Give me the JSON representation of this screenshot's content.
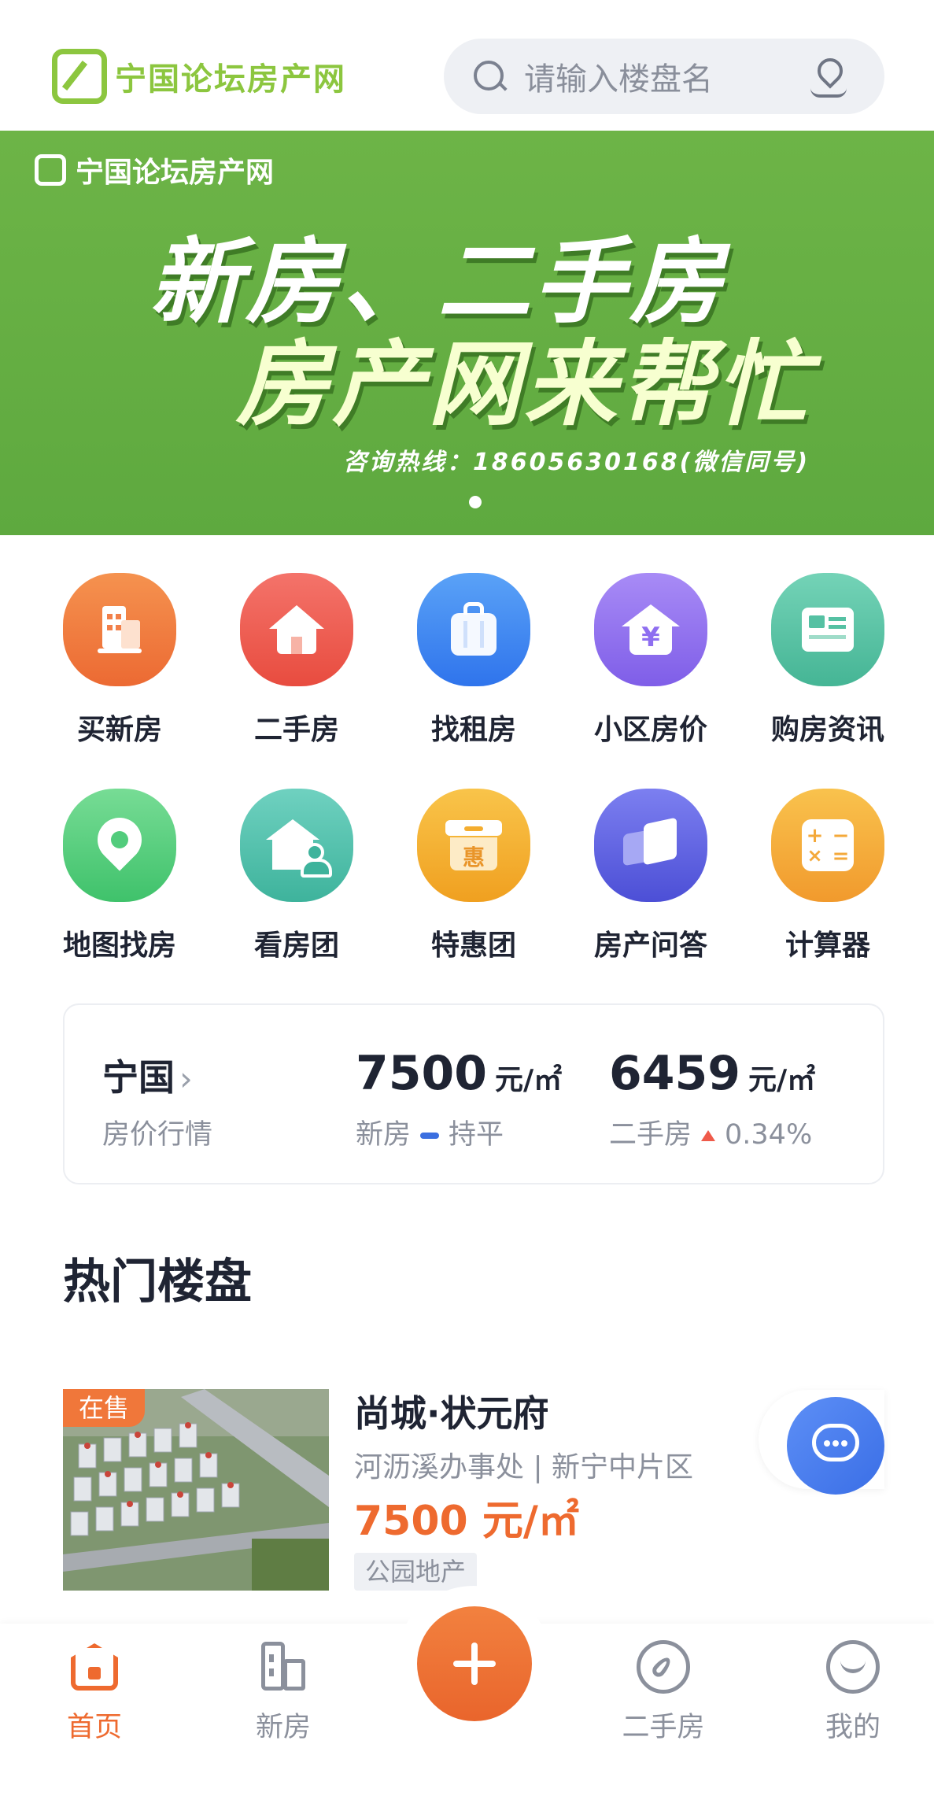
{
  "header": {
    "logo_text": "宁国论坛房产网",
    "search_placeholder": "请输入楼盘名"
  },
  "banner": {
    "brand": "宁国论坛房产网",
    "line1": "新房、二手房",
    "line2": "房产网来帮忙",
    "hotline": "咨询热线：18605630168(微信同号)"
  },
  "nav": {
    "items": [
      {
        "label": "买新房",
        "icon": "building-icon",
        "color": "#f0773a"
      },
      {
        "label": "二手房",
        "icon": "house-icon",
        "color": "#ef5a4a"
      },
      {
        "label": "找租房",
        "icon": "luggage-icon",
        "color": "#3b86f2"
      },
      {
        "label": "小区房价",
        "icon": "yuan-house-icon",
        "color": "#8e6ef0"
      },
      {
        "label": "购房资讯",
        "icon": "news-icon",
        "color": "#55c1a3"
      },
      {
        "label": "地图找房",
        "icon": "map-pin-icon",
        "color": "#52cc7c"
      },
      {
        "label": "看房团",
        "icon": "group-house-icon",
        "color": "#4fc2ad"
      },
      {
        "label": "特惠团",
        "icon": "discount-box-icon",
        "color": "#f4ad2f"
      },
      {
        "label": "房产问答",
        "icon": "flag-qa-icon",
        "color": "#5c60e0"
      },
      {
        "label": "计算器",
        "icon": "calculator-icon",
        "color": "#f4a93a"
      }
    ]
  },
  "price_card": {
    "city": "宁国",
    "subtitle": "房价行情",
    "new_price": "7500",
    "unit": "元/㎡",
    "new_label": "新房",
    "new_trend": "持平",
    "second_price": "6459",
    "second_label": "二手房",
    "second_trend": "0.34%"
  },
  "section": {
    "title": "热门楼盘"
  },
  "listing": {
    "status": "在售",
    "name": "尚城·状元府",
    "location": "河沥溪办事处 | 新宁中片区",
    "price": "7500 元/㎡",
    "tag": "公园地产"
  },
  "tabbar": {
    "items": [
      {
        "label": "首页"
      },
      {
        "label": "新房"
      },
      {
        "label": "二手房"
      },
      {
        "label": "我的"
      }
    ]
  }
}
